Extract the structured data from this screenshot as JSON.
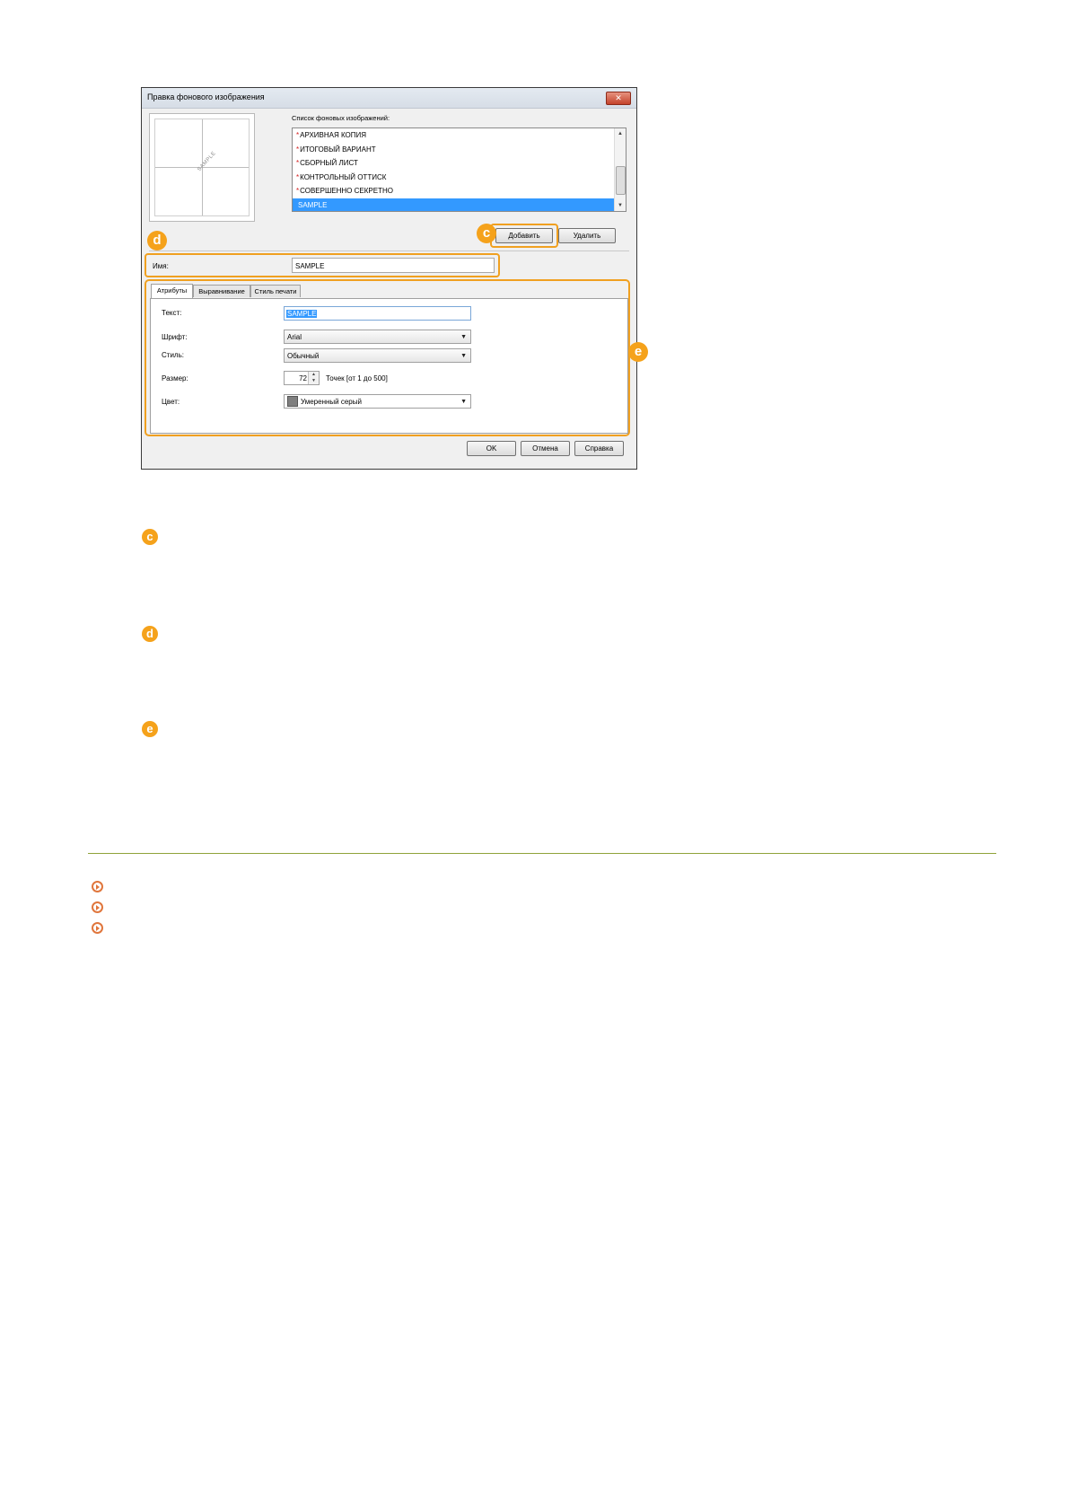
{
  "dialog": {
    "title": "Правка фонового изображения",
    "close_label": "✕",
    "preview_text": "SAMPLE",
    "list_label": "Список фоновых изображений:",
    "list_items": [
      {
        "label": "АРХИВНАЯ КОПИЯ",
        "builtin": true,
        "selected": false
      },
      {
        "label": "ИТОГОВЫЙ ВАРИАНТ",
        "builtin": true,
        "selected": false
      },
      {
        "label": "СБОРНЫЙ ЛИСТ",
        "builtin": true,
        "selected": false
      },
      {
        "label": "КОНТРОЛЬНЫЙ ОТТИСК",
        "builtin": true,
        "selected": false
      },
      {
        "label": "СОВЕРШЕННО СЕКРЕТНО",
        "builtin": true,
        "selected": false
      },
      {
        "label": "SAMPLE",
        "builtin": false,
        "selected": true
      }
    ],
    "add_button": "Добавить",
    "delete_button": "Удалить",
    "name_label": "Имя:",
    "name_value": "SAMPLE",
    "tabs": [
      "Атрибуты",
      "Выравнивание",
      "Стиль печати"
    ],
    "fields": {
      "text_label": "Текст:",
      "text_value": "SAMPLE",
      "font_label": "Шрифт:",
      "font_value": "Arial",
      "style_label": "Стиль:",
      "style_value": "Обычный",
      "size_label": "Размер:",
      "size_value": "72",
      "size_unit": "Точек [от 1 до 500]",
      "color_label": "Цвет:",
      "color_value": "Умеренный серый"
    },
    "ok_button": "OK",
    "cancel_button": "Отмена",
    "help_button": "Справка"
  },
  "callouts": {
    "c": "c",
    "d": "d",
    "e": "e"
  },
  "colors": {
    "accent": "#f5a21b",
    "selection": "#3399ff",
    "rule": "#8fa23a",
    "link_icon": "#e0763c"
  },
  "links": {
    "icon": "circled-arrow-icon",
    "count": 3
  }
}
